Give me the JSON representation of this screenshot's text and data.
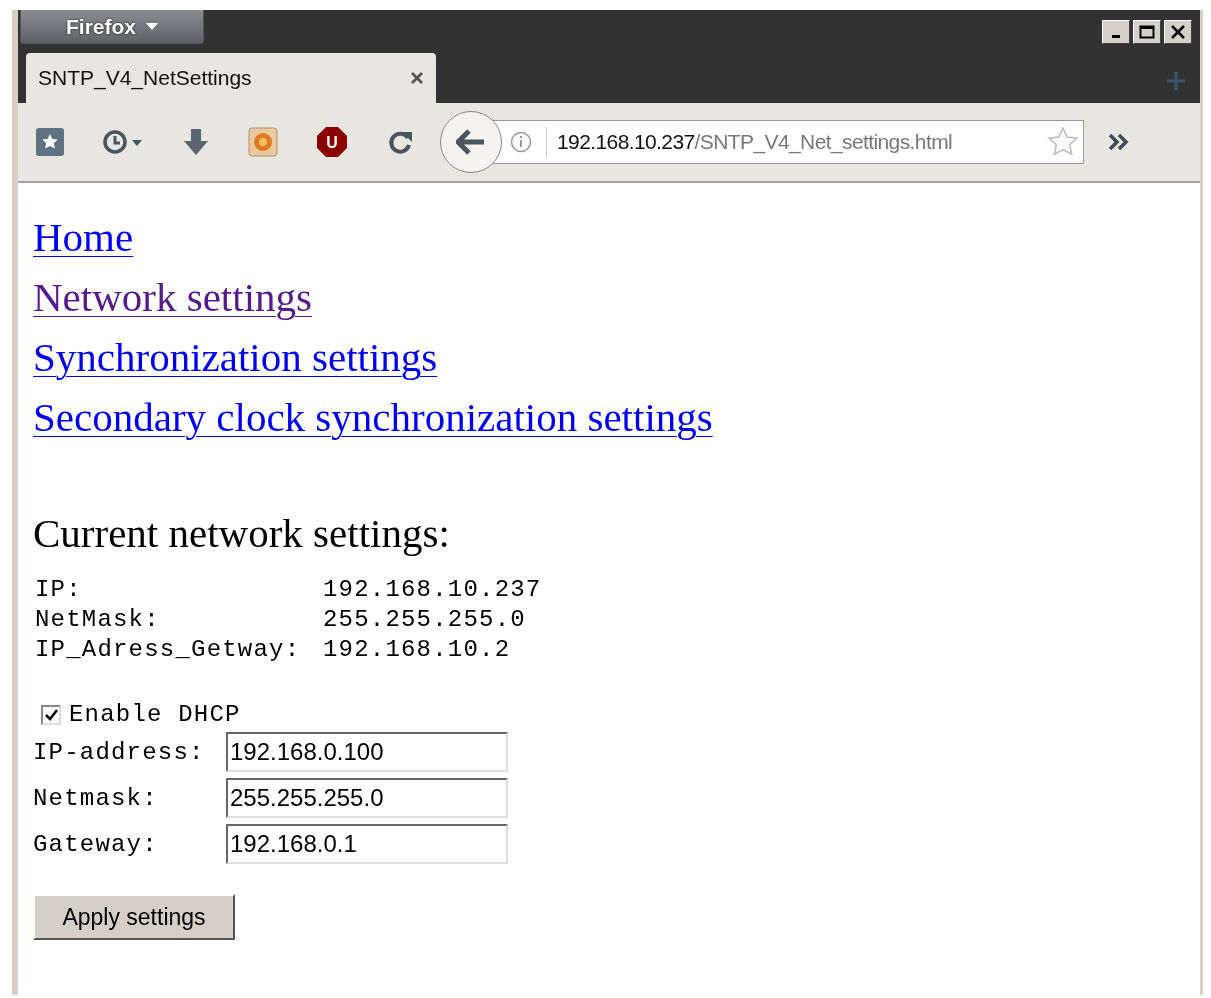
{
  "browser": {
    "menu_button": "Firefox",
    "tabs": [
      {
        "title": "SNTP_V4_NetSettings",
        "selected": true
      }
    ],
    "addon_badge": "U",
    "url": {
      "host": "192.168.10.237",
      "path": "/SNTP_V4_Net_settings.html"
    }
  },
  "page": {
    "links": [
      {
        "text": "Home",
        "visited": false
      },
      {
        "text": "Network settings",
        "visited": true
      },
      {
        "text": "Synchronization settings",
        "visited": false
      },
      {
        "text": "Secondary clock synchronization settings",
        "visited": false
      }
    ],
    "heading": "Current network settings:",
    "current": [
      {
        "label": "IP:",
        "value": "192.168.10.237"
      },
      {
        "label": "NetMask:",
        "value": "255.255.255.0"
      },
      {
        "label": "IP_Adress_Getway:",
        "value": "192.168.10.2"
      }
    ],
    "dhcp": {
      "label": "Enable DHCP",
      "checked": true
    },
    "fields": [
      {
        "label": "IP-address:",
        "value": "192.168.0.100"
      },
      {
        "label": "Netmask:",
        "value": "255.255.255.0"
      },
      {
        "label": "Gateway:",
        "value": "192.168.0.1"
      }
    ],
    "button": "Apply settings"
  }
}
